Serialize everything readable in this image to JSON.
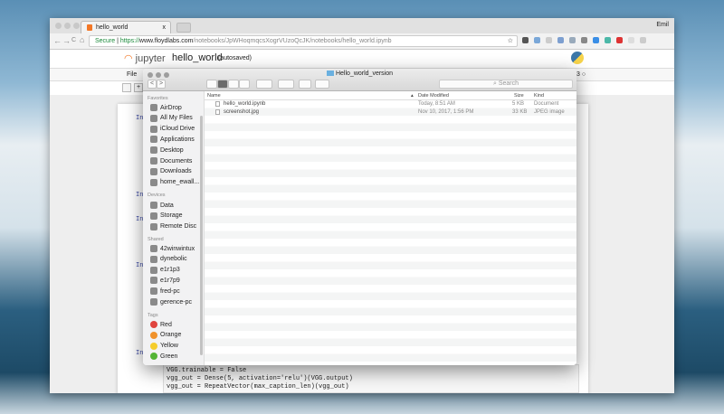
{
  "browser": {
    "tab_title": "hello_world",
    "tab_close": "x",
    "user": "Emil",
    "url_secure": "Secure",
    "url_scheme": "https://",
    "url_host": "www.floydlabs.com",
    "url_path": "/notebooks/JpWHoqmqcsXogrVUzoQcJK/notebooks/hello_world.ipynb",
    "back": "←",
    "forward": "→",
    "reload": "C",
    "home": "⌂",
    "star": "☆"
  },
  "jupyter": {
    "logo": "jupyter",
    "notebook_name": "hello_world",
    "save_status": "(autosaved)",
    "menu_file": "File",
    "kernel_indicator": "3 ○",
    "prompts": [
      "In",
      "In",
      "In",
      "In",
      "In"
    ],
    "code_lines": [
      "VGG.trainable = False",
      "vgg_out = Dense(5, activation='relu')(VGG.output)",
      "vgg_out = RepeatVector(max_caption_len)(vgg_out)"
    ]
  },
  "finder": {
    "title": "Hello_world_version",
    "search_placeholder": "Search",
    "back": "<",
    "forward": ">",
    "sections": {
      "favorites": "Favorites",
      "devices": "Devices",
      "shared": "Shared",
      "tags": "Tags"
    },
    "favorites": [
      {
        "label": "AirDrop",
        "icon": "airdrop-icon"
      },
      {
        "label": "All My Files",
        "icon": "all-files-icon"
      },
      {
        "label": "iCloud Drive",
        "icon": "cloud-icon"
      },
      {
        "label": "Applications",
        "icon": "applications-icon"
      },
      {
        "label": "Desktop",
        "icon": "desktop-icon"
      },
      {
        "label": "Documents",
        "icon": "documents-icon"
      },
      {
        "label": "Downloads",
        "icon": "downloads-icon"
      },
      {
        "label": "home_ewall...",
        "icon": "folder-icon"
      }
    ],
    "devices": [
      {
        "label": "Data"
      },
      {
        "label": "Storage"
      },
      {
        "label": "Remote Disc"
      }
    ],
    "shared": [
      {
        "label": "42winwintux"
      },
      {
        "label": "dynebolic"
      },
      {
        "label": "e1r1p3"
      },
      {
        "label": "e1r7p9"
      },
      {
        "label": "fred-pc"
      },
      {
        "label": "gerence-pc"
      }
    ],
    "tags": [
      {
        "label": "Red",
        "color": "#e0443e"
      },
      {
        "label": "Orange",
        "color": "#f0922b"
      },
      {
        "label": "Yellow",
        "color": "#f5cd2c"
      },
      {
        "label": "Green",
        "color": "#54b435"
      }
    ],
    "columns": {
      "name": "Name",
      "date": "Date Modified",
      "size": "Size",
      "kind": "Kind"
    },
    "files": [
      {
        "name": "hello_world.ipynb",
        "date": "Today, 8:51 AM",
        "size": "5 KB",
        "kind": "Document"
      },
      {
        "name": "screenshot.jpg",
        "date": "Nov 10, 2017, 1:56 PM",
        "size": "33 KB",
        "kind": "JPEG image"
      }
    ]
  }
}
